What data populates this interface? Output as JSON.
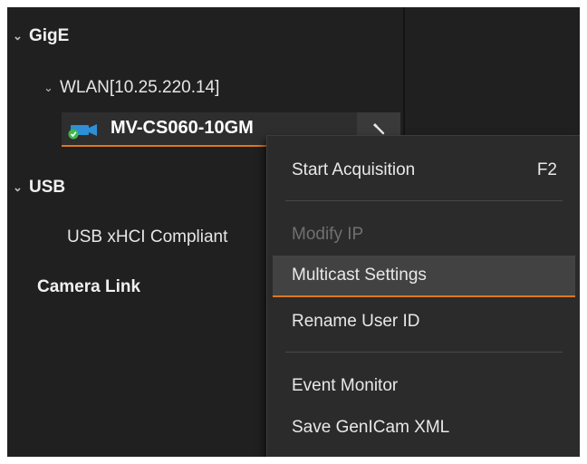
{
  "tree": {
    "gige": {
      "label": "GigE",
      "expanded": true
    },
    "wlan": {
      "label": "WLAN[10.25.220.14]",
      "expanded": true
    },
    "device": {
      "label": "MV-CS060-10GM",
      "status": "connected",
      "icon": "camera-icon"
    },
    "usb": {
      "label": "USB",
      "expanded": true
    },
    "usb_controller": {
      "label": "USB xHCI Compliant"
    },
    "camera_link": {
      "label": "Camera Link"
    }
  },
  "context_menu": {
    "items": [
      {
        "label": "Start Acquisition",
        "shortcut": "F2",
        "enabled": true
      },
      {
        "label": "Modify IP",
        "enabled": false
      },
      {
        "label": "Multicast Settings",
        "enabled": true,
        "highlighted": true
      },
      {
        "label": "Rename User ID",
        "enabled": true
      },
      {
        "label": "Event Monitor",
        "enabled": true
      },
      {
        "label": "Save GenICam XML",
        "enabled": true
      }
    ]
  },
  "colors": {
    "background": "#202020",
    "menu_background": "#2b2b2b",
    "accent": "#e0761c",
    "status_ok": "#3cb94a",
    "camera_icon": "#2f8fd6"
  }
}
